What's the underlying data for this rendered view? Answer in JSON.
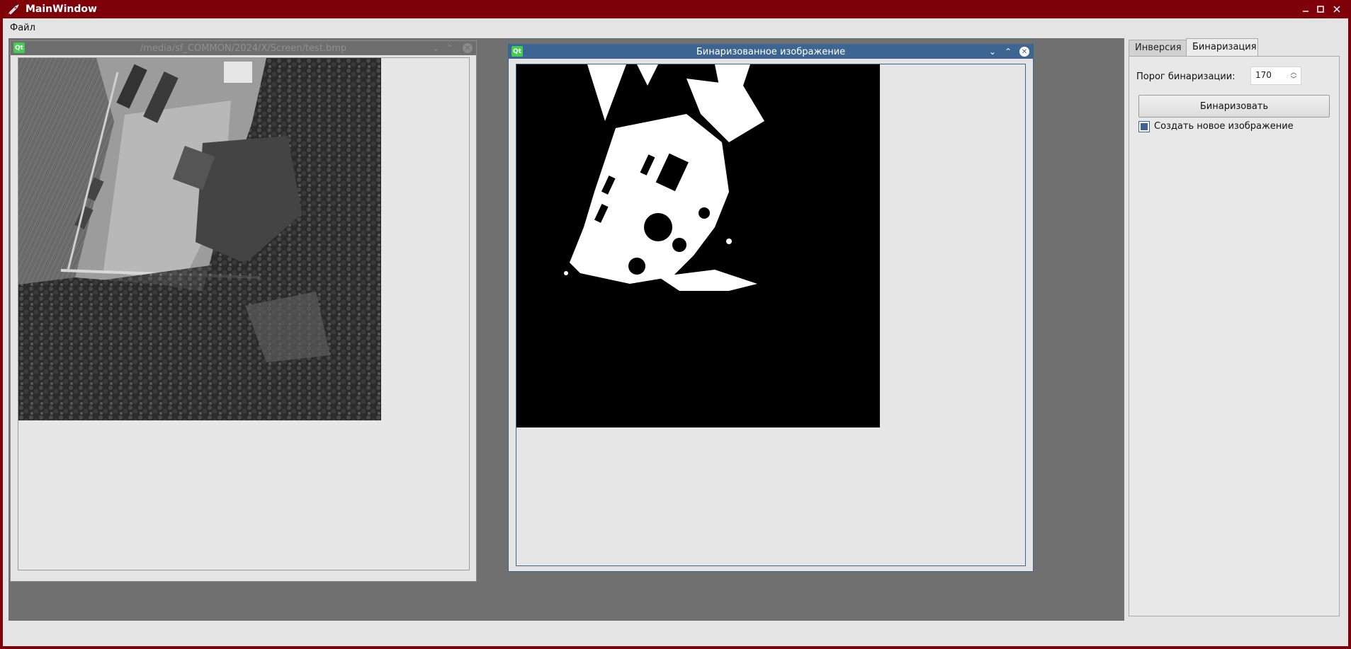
{
  "window": {
    "title": "MainWindow"
  },
  "menu": {
    "file": "Файл"
  },
  "subwindow_original": {
    "title": "/media/sf_COMMON/2024/X/Screen/test.bmp"
  },
  "subwindow_binary": {
    "title": "Бинаризованное изображение"
  },
  "panel": {
    "tabs": [
      "Инверсия",
      "Бинаризация"
    ],
    "active_tab": "Бинаризация",
    "threshold_label": "Порог бинаризации:",
    "threshold_value": "170",
    "binarize_button": "Бинаризовать",
    "new_image_checkbox": "Создать новое изображение",
    "new_image_checked": true
  },
  "icons": {
    "app": "rocket-icon",
    "qt": "qt-logo-icon"
  },
  "colors": {
    "titlebar": "#7e0008",
    "active_subwindow": "#3d6591",
    "mdi_background": "#707070"
  }
}
